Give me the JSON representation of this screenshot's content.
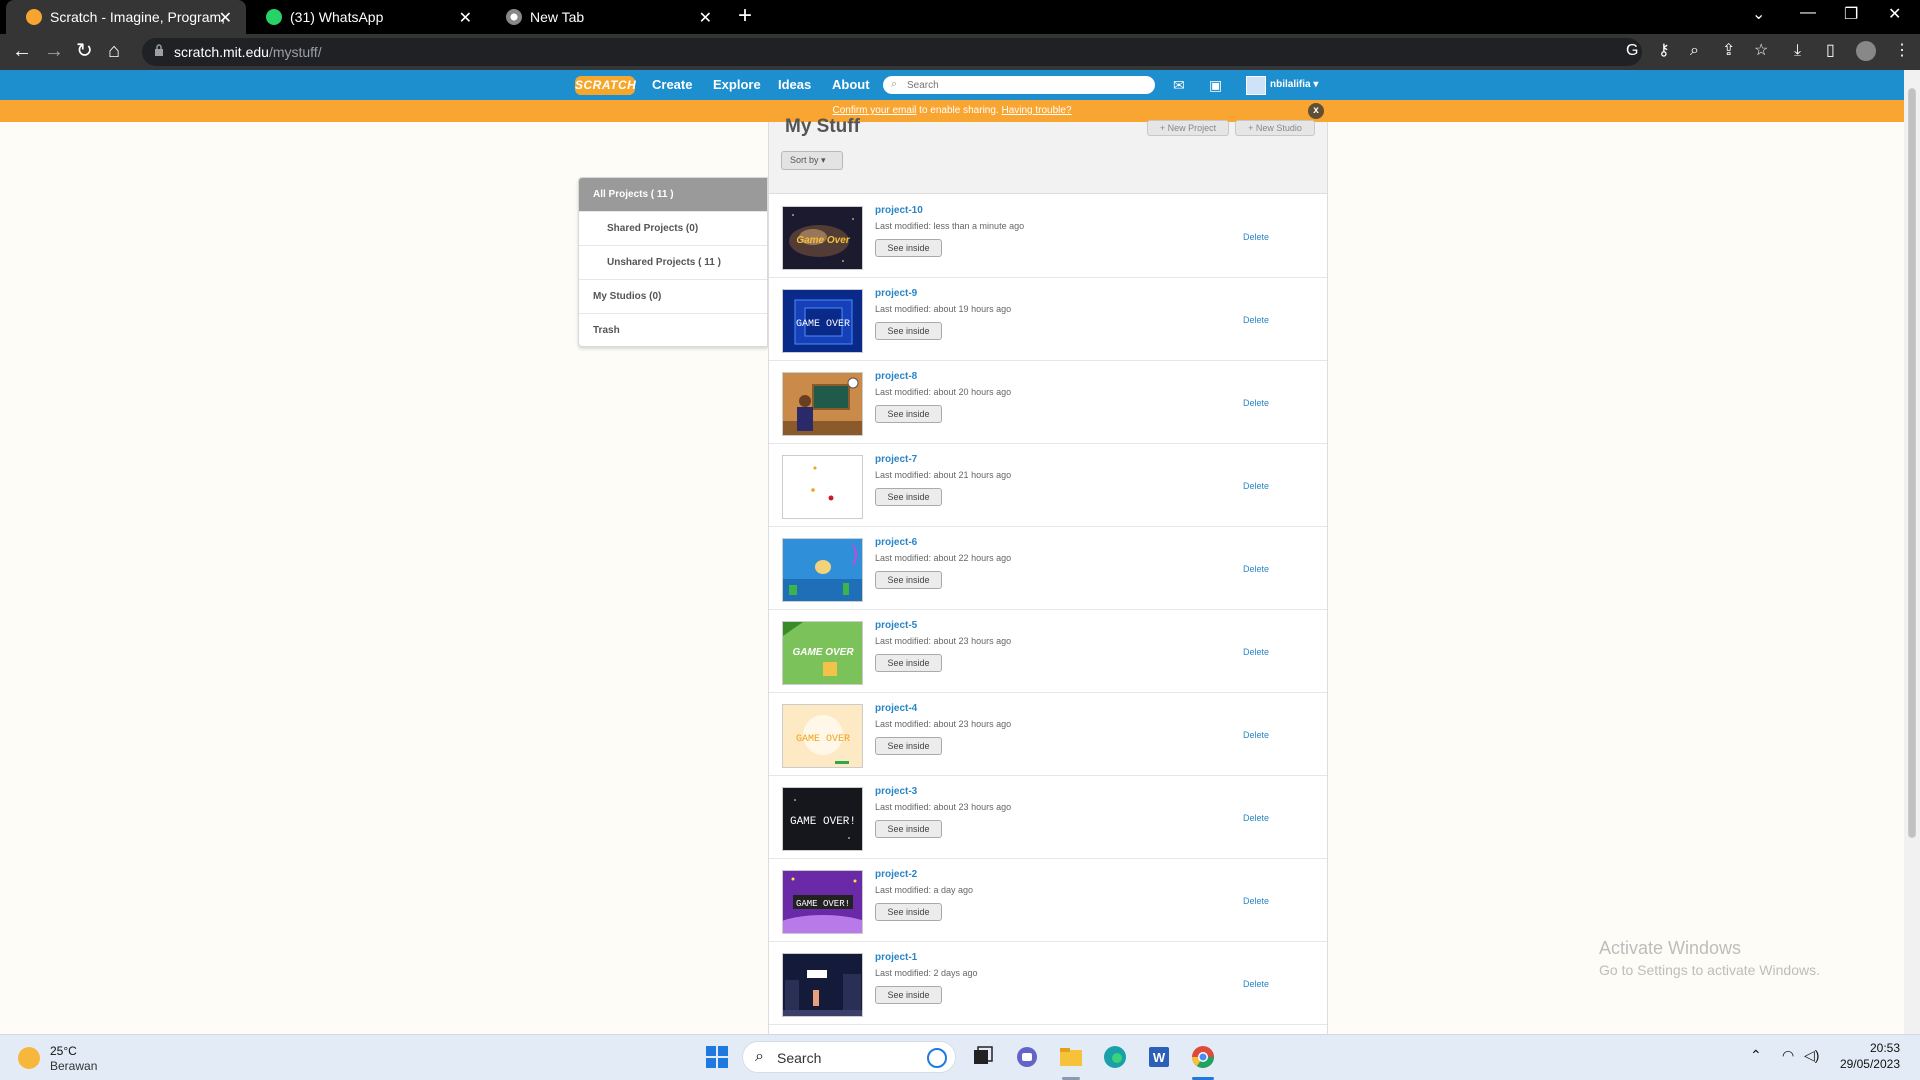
{
  "browser": {
    "tabs": [
      {
        "title": "Scratch - Imagine, Program, Share",
        "active": true,
        "icon": "scratch-favicon"
      },
      {
        "title": "(31) WhatsApp",
        "active": false,
        "icon": "whatsapp-favicon"
      },
      {
        "title": "New Tab",
        "active": false,
        "icon": "chrome-favicon"
      }
    ],
    "url_host": "scratch.mit.edu",
    "url_path": "/mystuff/"
  },
  "scratch_nav": {
    "logo": "SCRATCH",
    "links": [
      "Create",
      "Explore",
      "Ideas",
      "About"
    ],
    "search_placeholder": "Search",
    "username": "nbilalifia ▾"
  },
  "banner": {
    "link1": "Confirm your email",
    "text": " to enable sharing. ",
    "link2": "Having trouble?",
    "close": "x"
  },
  "mystuff": {
    "title": "My Stuff",
    "new_project": "+ New Project",
    "new_studio": "+ New Studio",
    "sort_by": "Sort by ▾"
  },
  "sidebar": [
    "All Projects ( 11 )",
    "Shared Projects (0)",
    "Unshared Projects ( 11 )",
    "My Studios (0)",
    "Trash"
  ],
  "projects": [
    {
      "title": "project-10",
      "modified": "Last modified: less than a minute ago",
      "see_inside": "See inside",
      "delete": "Delete",
      "thumb_text": "Game Over"
    },
    {
      "title": "project-9",
      "modified": "Last modified: about 19 hours ago",
      "see_inside": "See inside",
      "delete": "Delete",
      "thumb_text": "GAME OVER"
    },
    {
      "title": "project-8",
      "modified": "Last modified: about 20 hours ago",
      "see_inside": "See inside",
      "delete": "Delete",
      "thumb_text": ""
    },
    {
      "title": "project-7",
      "modified": "Last modified: about 21 hours ago",
      "see_inside": "See inside",
      "delete": "Delete",
      "thumb_text": ""
    },
    {
      "title": "project-6",
      "modified": "Last modified: about 22 hours ago",
      "see_inside": "See inside",
      "delete": "Delete",
      "thumb_text": ""
    },
    {
      "title": "project-5",
      "modified": "Last modified: about 23 hours ago",
      "see_inside": "See inside",
      "delete": "Delete",
      "thumb_text": "GAME OVER"
    },
    {
      "title": "project-4",
      "modified": "Last modified: about 23 hours ago",
      "see_inside": "See inside",
      "delete": "Delete",
      "thumb_text": "GAME OVER"
    },
    {
      "title": "project-3",
      "modified": "Last modified: about 23 hours ago",
      "see_inside": "See inside",
      "delete": "Delete",
      "thumb_text": "GAME OVER!"
    },
    {
      "title": "project-2",
      "modified": "Last modified: a day ago",
      "see_inside": "See inside",
      "delete": "Delete",
      "thumb_text": "GAME OVER!"
    },
    {
      "title": "project-1",
      "modified": "Last modified: 2 days ago",
      "see_inside": "See inside",
      "delete": "Delete",
      "thumb_text": ""
    }
  ],
  "watermark": {
    "line1": "Activate Windows",
    "line2": "Go to Settings to activate Windows."
  },
  "taskbar": {
    "temperature": "25°C",
    "condition": "Berawan",
    "search": "Search",
    "time": "20:53",
    "date": "29/05/2023"
  },
  "colors": {
    "scratch_blue": "#1d8fce",
    "banner_orange": "#f9a532",
    "link_blue": "#2a85c7"
  }
}
